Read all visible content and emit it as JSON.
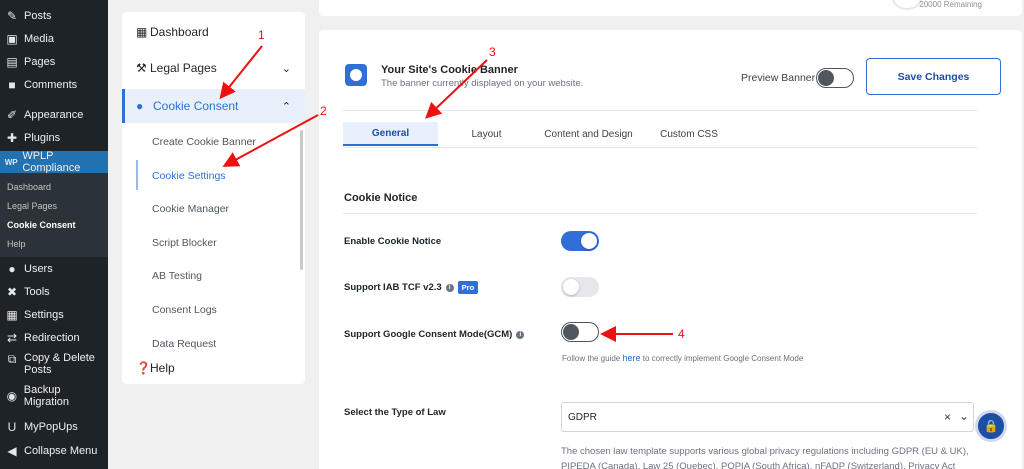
{
  "wp_menu": [
    {
      "icon": "pin-icon",
      "glyph": "✎",
      "label": "Posts"
    },
    {
      "icon": "media-icon",
      "glyph": "▣",
      "label": "Media"
    },
    {
      "icon": "pages-icon",
      "glyph": "▤",
      "label": "Pages"
    },
    {
      "icon": "comments-icon",
      "glyph": "■",
      "label": "Comments"
    },
    {
      "icon": "appearance-icon",
      "glyph": "✐",
      "label": "Appearance"
    },
    {
      "icon": "plugins-icon",
      "glyph": "✚",
      "label": "Plugins"
    },
    {
      "icon": "wplp-icon",
      "glyph": "WP",
      "label": "WPLP Compliance"
    },
    {
      "icon": "users-icon",
      "glyph": "●",
      "label": "Users"
    },
    {
      "icon": "tools-icon",
      "glyph": "✖",
      "label": "Tools"
    },
    {
      "icon": "settings-icon",
      "glyph": "▦",
      "label": "Settings"
    },
    {
      "icon": "redirection-icon",
      "glyph": "⇄",
      "label": "Redirection"
    },
    {
      "icon": "copy-icon",
      "glyph": "⧉",
      "label": "Copy & Delete",
      "label2": "Posts"
    },
    {
      "icon": "backup-icon",
      "glyph": "◉",
      "label": "Backup Migration"
    },
    {
      "icon": "mypopups-icon",
      "glyph": "U",
      "label": "MyPopUps"
    },
    {
      "icon": "collapse-icon",
      "glyph": "◀",
      "label": "Collapse Menu"
    }
  ],
  "wp_submenu": [
    "Dashboard",
    "Legal Pages",
    "Cookie Consent",
    "Help"
  ],
  "plugin_nav": {
    "dashboard": "Dashboard",
    "legal_pages": "Legal Pages",
    "cookie_consent": "Cookie Consent",
    "sub": [
      "Create Cookie Banner",
      "Cookie Settings",
      "Cookie Manager",
      "Script Blocker",
      "AB Testing",
      "Consent Logs",
      "Data Request"
    ],
    "help": "Help"
  },
  "top_card": {
    "remaining": "20000 Remaining"
  },
  "banner": {
    "title": "Your Site's Cookie Banner",
    "subtitle": "The banner currently displayed on your website.",
    "preview_label": "Preview Banner",
    "save_label": "Save Changes"
  },
  "tabs": [
    "General",
    "Layout",
    "Content and Design",
    "Custom CSS"
  ],
  "section_title": "Cookie Notice",
  "settings": {
    "enable_notice": {
      "label": "Enable Cookie Notice",
      "on": true
    },
    "iab": {
      "label": "Support IAB TCF v2.3",
      "badge": "Pro",
      "on": false
    },
    "gcm": {
      "label": "Support Google Consent Mode(GCM)",
      "on": false,
      "help_prefix": "Follow the guide",
      "help_link": "here",
      "help_suffix": "to correctly implement Google Consent Mode"
    }
  },
  "law": {
    "label": "Select the Type of Law",
    "value": "GDPR",
    "clear": "×",
    "chevron": "⌄",
    "description": "The chosen law template supports various global privacy regulations including GDPR (EU & UK), PIPEDA (Canada), Law 25 (Quebec), POPIA (South Africa), nFADP (Switzerland), Privacy Act"
  },
  "annotations": [
    "1",
    "2",
    "3",
    "4"
  ],
  "colors": {
    "accent": "#2f6fd6",
    "wp_active": "#2271b1",
    "annotation": "#ee1111"
  }
}
